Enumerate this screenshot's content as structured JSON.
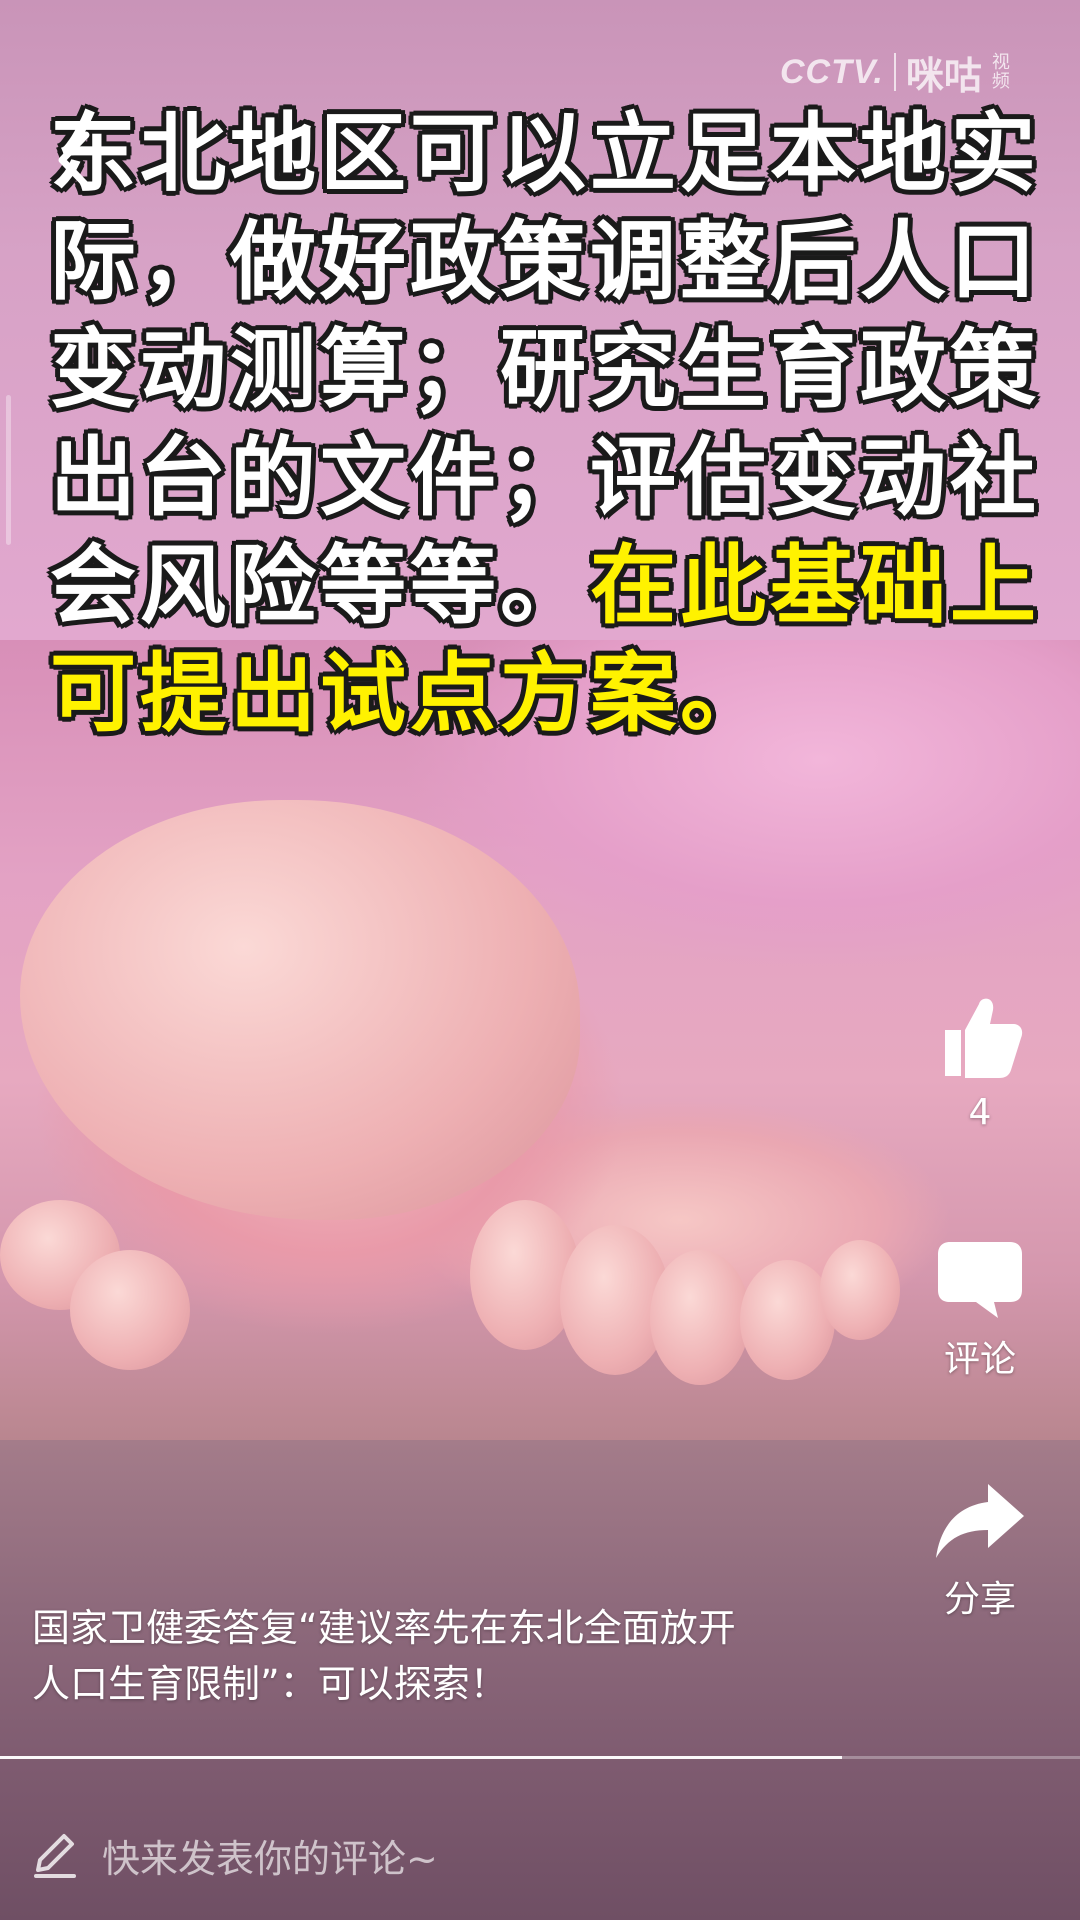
{
  "watermark": {
    "brand_cctv": "CCTV.",
    "brand_migu": "咪咕",
    "brand_video": "视频"
  },
  "headline": {
    "white_text": "东北地区可以立足本地实际，做好政策调整后人口变动测算；研究生育政策出台的文件；评估变动社会风险等等。",
    "yellow_text": "在此基础上可提出试点方案。"
  },
  "actions": {
    "like_count": "4",
    "comment_label": "评论",
    "share_label": "分享"
  },
  "caption": {
    "line1": "国家卫健委答复“建议率先在东北全面放开",
    "line2": "人口生育限制”：可以探索！"
  },
  "progress": {
    "fraction": 0.78
  },
  "comment_bar": {
    "placeholder": "快来发表你的评论~"
  },
  "icons": {
    "back": "back-chevron-icon",
    "like": "thumbs-up-icon",
    "comment": "chat-bubble-icon",
    "share": "share-arrow-icon",
    "pen": "pen-icon"
  }
}
